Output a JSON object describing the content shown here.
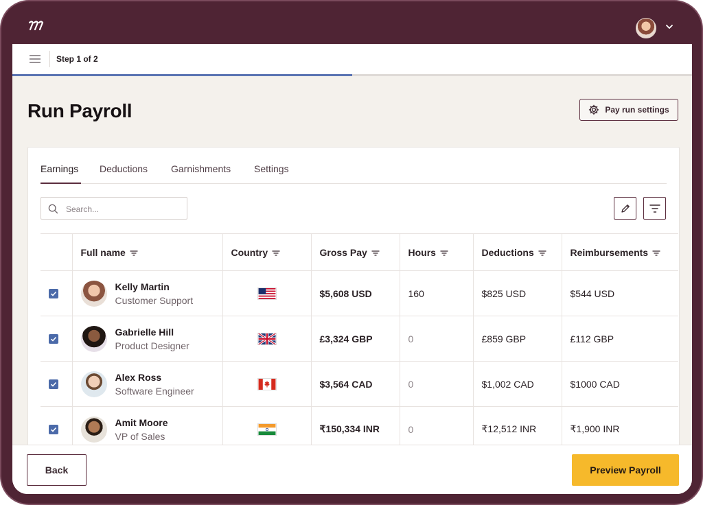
{
  "header": {
    "logo_icon": "app-logo-icon",
    "account_icon": "chevron-down-icon"
  },
  "stepbar": {
    "step_label": "Step 1 of 2",
    "progress_fraction": 0.5
  },
  "page": {
    "title": "Run Payroll",
    "settings_button": "Pay run settings"
  },
  "tabs": [
    {
      "label": "Earnings",
      "active": true
    },
    {
      "label": "Deductions",
      "active": false
    },
    {
      "label": "Garnishments",
      "active": false
    },
    {
      "label": "Settings",
      "active": false
    }
  ],
  "search": {
    "placeholder": "Search..."
  },
  "table": {
    "columns": [
      "Full name",
      "Country",
      "Gross Pay",
      "Hours",
      "Deductions",
      "Reimbursements"
    ],
    "rows": [
      {
        "name": "Kelly Martin",
        "role": "Customer Support",
        "country_flag": "us-flag-icon",
        "gross_pay": "$5,608 USD",
        "hours": "160",
        "deductions": "$825 USD",
        "reimbursements": "$544 USD",
        "checked": true
      },
      {
        "name": "Gabrielle Hill",
        "role": "Product Designer",
        "country_flag": "uk-flag-icon",
        "gross_pay": "£3,324 GBP",
        "hours": "0",
        "deductions": "£859 GBP",
        "reimbursements": "£112 GBP",
        "checked": true
      },
      {
        "name": "Alex Ross",
        "role": "Software Engineer",
        "country_flag": "canada-flag-icon",
        "gross_pay": "$3,564 CAD",
        "hours": "0",
        "deductions": "$1,002 CAD",
        "reimbursements": "$1000 CAD",
        "checked": true
      },
      {
        "name": "Amit Moore",
        "role": "VP of Sales",
        "country_flag": "india-flag-icon",
        "gross_pay": "₹150,334 INR",
        "hours": "0",
        "deductions": "₹12,512 INR",
        "reimbursements": "₹1,900 INR",
        "checked": true
      }
    ]
  },
  "footer": {
    "back_button": "Back",
    "preview_button": "Preview Payroll"
  },
  "colors": {
    "brand": "#4f2434",
    "accent": "#f6b92b",
    "progress": "#5a74b3",
    "checkbox": "#4b6aa9"
  }
}
